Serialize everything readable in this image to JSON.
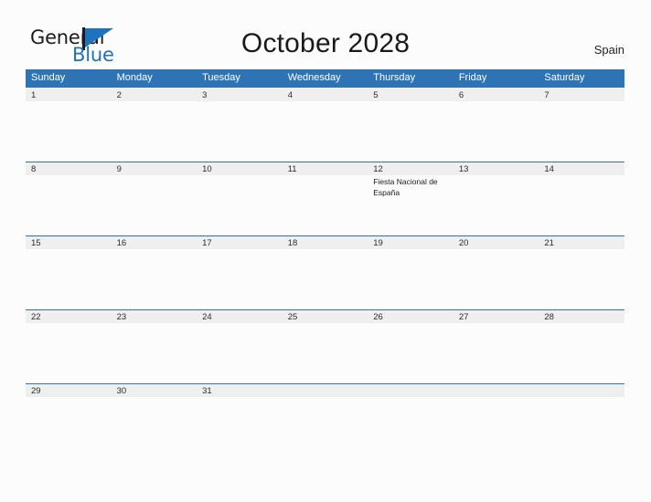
{
  "brand": {
    "name_top": "General",
    "name_bottom": "Blue",
    "flag_icon": "flag-icon",
    "accent_color": "#1f72bd"
  },
  "header": {
    "title": "October 2028",
    "country": "Spain"
  },
  "theme": {
    "header_blue": "#2e74b5",
    "band_gray": "#efefef",
    "page_background": "#fcfcfc",
    "text": "#222222"
  },
  "calendar": {
    "weekday_headers": [
      "Sunday",
      "Monday",
      "Tuesday",
      "Wednesday",
      "Thursday",
      "Friday",
      "Saturday"
    ],
    "weeks": [
      {
        "days": [
          {
            "num": "1",
            "events": []
          },
          {
            "num": "2",
            "events": []
          },
          {
            "num": "3",
            "events": []
          },
          {
            "num": "4",
            "events": []
          },
          {
            "num": "5",
            "events": []
          },
          {
            "num": "6",
            "events": []
          },
          {
            "num": "7",
            "events": []
          }
        ]
      },
      {
        "days": [
          {
            "num": "8",
            "events": []
          },
          {
            "num": "9",
            "events": []
          },
          {
            "num": "10",
            "events": []
          },
          {
            "num": "11",
            "events": []
          },
          {
            "num": "12",
            "events": [
              "Fiesta Nacional de España"
            ]
          },
          {
            "num": "13",
            "events": []
          },
          {
            "num": "14",
            "events": []
          }
        ]
      },
      {
        "days": [
          {
            "num": "15",
            "events": []
          },
          {
            "num": "16",
            "events": []
          },
          {
            "num": "17",
            "events": []
          },
          {
            "num": "18",
            "events": []
          },
          {
            "num": "19",
            "events": []
          },
          {
            "num": "20",
            "events": []
          },
          {
            "num": "21",
            "events": []
          }
        ]
      },
      {
        "days": [
          {
            "num": "22",
            "events": []
          },
          {
            "num": "23",
            "events": []
          },
          {
            "num": "24",
            "events": []
          },
          {
            "num": "25",
            "events": []
          },
          {
            "num": "26",
            "events": []
          },
          {
            "num": "27",
            "events": []
          },
          {
            "num": "28",
            "events": []
          }
        ]
      },
      {
        "days": [
          {
            "num": "29",
            "events": []
          },
          {
            "num": "30",
            "events": []
          },
          {
            "num": "31",
            "events": []
          },
          {
            "num": "",
            "events": []
          },
          {
            "num": "",
            "events": []
          },
          {
            "num": "",
            "events": []
          },
          {
            "num": "",
            "events": []
          }
        ]
      }
    ]
  }
}
